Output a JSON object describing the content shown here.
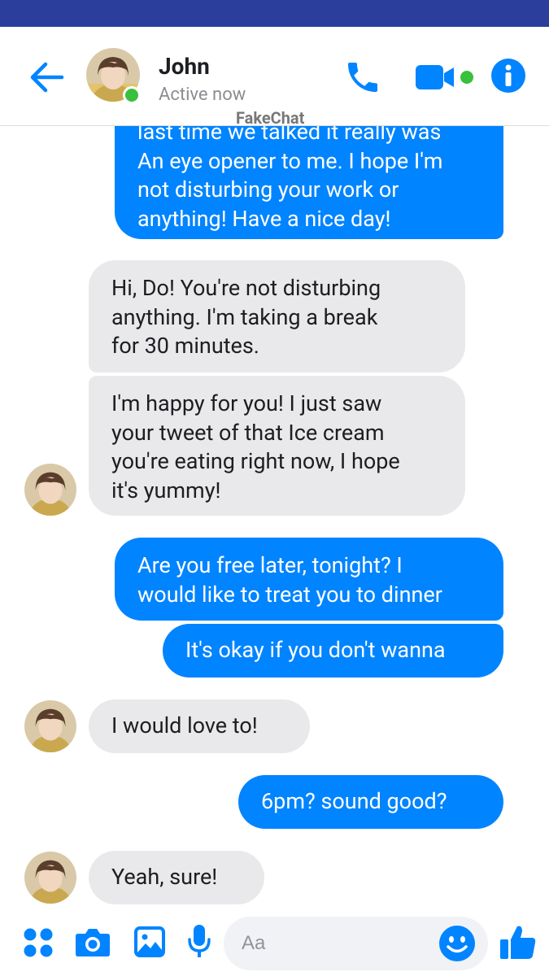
{
  "colors": {
    "status_bar": "#2c3e9b",
    "accent": "#0084ff",
    "incoming_bubble": "#e9e9eb",
    "online": "#39c03c"
  },
  "header": {
    "contact_name": "John",
    "contact_status": "Active now",
    "watermark": "FakeChat",
    "icons": [
      "back-arrow-icon",
      "phone-icon",
      "video-camera-icon",
      "info-icon"
    ]
  },
  "messages": [
    {
      "from": "me",
      "lines": [
        "last time we talked it really was",
        "An eye opener to me. I hope I'm",
        "not disturbing your work or",
        "anything!  Have a nice day!"
      ]
    },
    {
      "from": "John",
      "lines": [
        "Hi, Do! You're not disturbing",
        "anything. I'm taking a break",
        "for 30 minutes."
      ]
    },
    {
      "from": "John",
      "lines": [
        "I'm happy for you!  I just saw",
        "your tweet of that Ice cream",
        "you're eating right now,  I hope",
        "it's yummy!"
      ]
    },
    {
      "from": "me",
      "lines": [
        "Are you free later, tonight?  I",
        "would like to treat you to dinner"
      ]
    },
    {
      "from": "me",
      "lines": [
        "It's okay if you don't wanna"
      ]
    },
    {
      "from": "John",
      "lines": [
        "I would love to!"
      ]
    },
    {
      "from": "me",
      "lines": [
        "6pm? sound good?"
      ]
    },
    {
      "from": "John",
      "lines": [
        "Yeah, sure!"
      ]
    }
  ],
  "composer": {
    "placeholder": "Aa",
    "icons": [
      "apps-icon",
      "camera-icon",
      "image-icon",
      "microphone-icon",
      "emoji-icon",
      "thumbs-up-icon"
    ]
  }
}
